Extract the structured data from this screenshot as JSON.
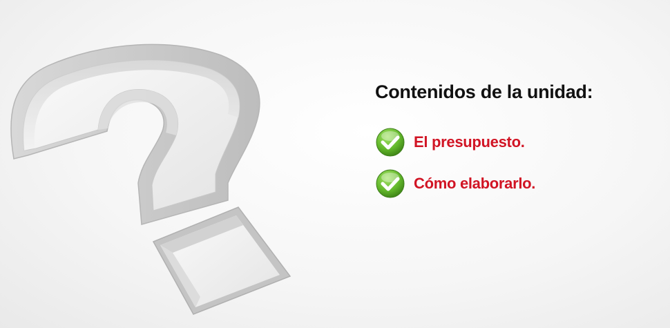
{
  "heading": "Contenidos de la unidad:",
  "items": [
    {
      "label": "El presupuesto.",
      "icon": "checkmark-icon"
    },
    {
      "label": "Cómo elaborarlo.",
      "icon": "checkmark-icon"
    }
  ],
  "colors": {
    "heading": "#111111",
    "item_text": "#d11424",
    "check_green": "#63b82b",
    "background": "#f4f4f4"
  }
}
